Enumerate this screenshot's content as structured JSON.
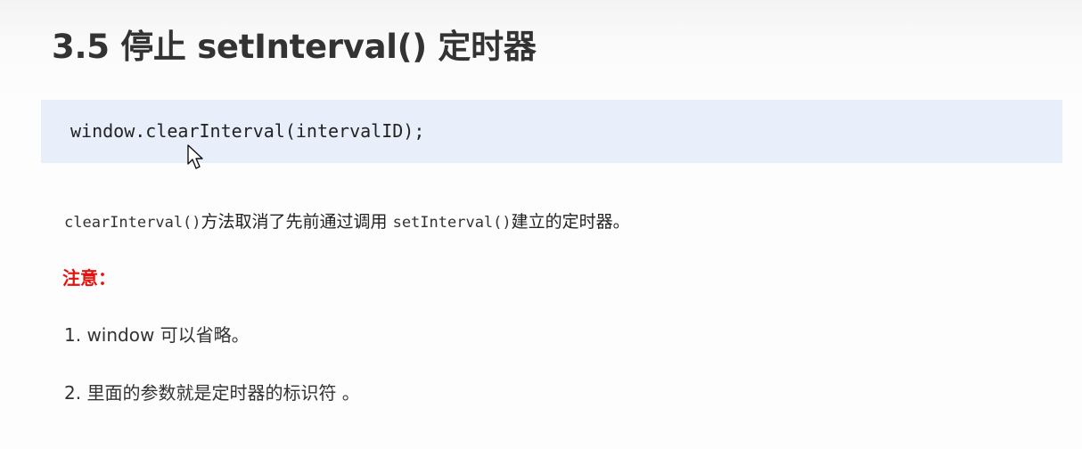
{
  "slide": {
    "title": "3.5 停止 setInterval()  定时器",
    "code": "window.clearInterval(intervalID);",
    "description": {
      "method_1": "clearInterval()",
      "text_1": "方法取消了先前通过调用 ",
      "method_2": "setInterval()",
      "text_2": "建立的定时器。"
    },
    "note_title": "注意：",
    "notes": [
      "1. window 可以省略。",
      "2. 里面的参数就是定时器的标识符 。"
    ]
  },
  "colors": {
    "code_background": "#e8eefa",
    "note_title": "#e5120c",
    "text": "#333333"
  },
  "icons": {
    "cursor": "mouse-pointer-icon"
  }
}
